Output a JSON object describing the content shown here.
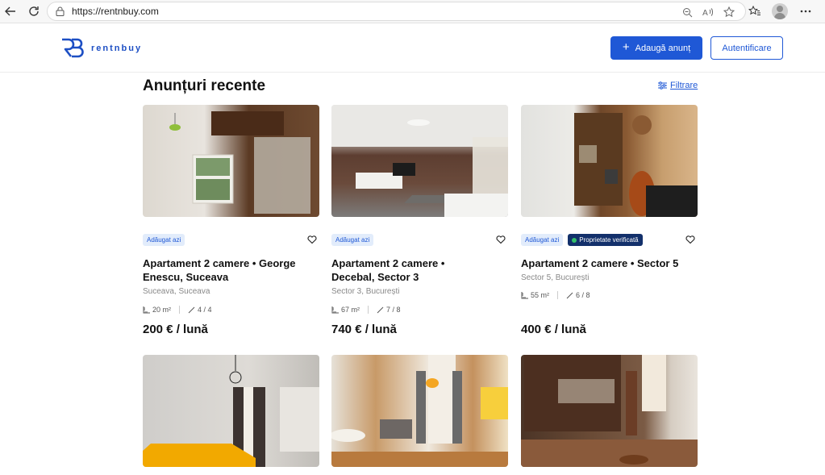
{
  "browser": {
    "url": "https://rentnbuy.com"
  },
  "header": {
    "brand": "rentnbuy",
    "add_label": "Adaugă anunț",
    "login_label": "Autentificare"
  },
  "main": {
    "title": "Anunțuri recente",
    "filter_label": "Filtrare"
  },
  "colors": {
    "accent": "#1f58d6",
    "verified_bg": "#13306b",
    "new_badge_bg": "#e2ecfb"
  },
  "listings": [
    {
      "badge": "Adăugat azi",
      "title": "Apartament 2 camere • George Enescu, Suceava",
      "location": "Suceava, Suceava",
      "area": "20 m²",
      "floor": "4 / 4",
      "price": "200 € / lună"
    },
    {
      "badge": "Adăugat azi",
      "title": "Apartament 2 camere • Decebal, Sector 3",
      "location": "Sector 3, București",
      "area": "67 m²",
      "floor": "7 / 8",
      "price": "740 € / lună"
    },
    {
      "badge": "Adăugat azi",
      "verified": "Proprietate verificată",
      "title": "Apartament 2 camere • Sector 5",
      "location": "Sector 5, București",
      "area": "55 m²",
      "floor": "6 / 8",
      "price": "400 € / lună"
    }
  ]
}
